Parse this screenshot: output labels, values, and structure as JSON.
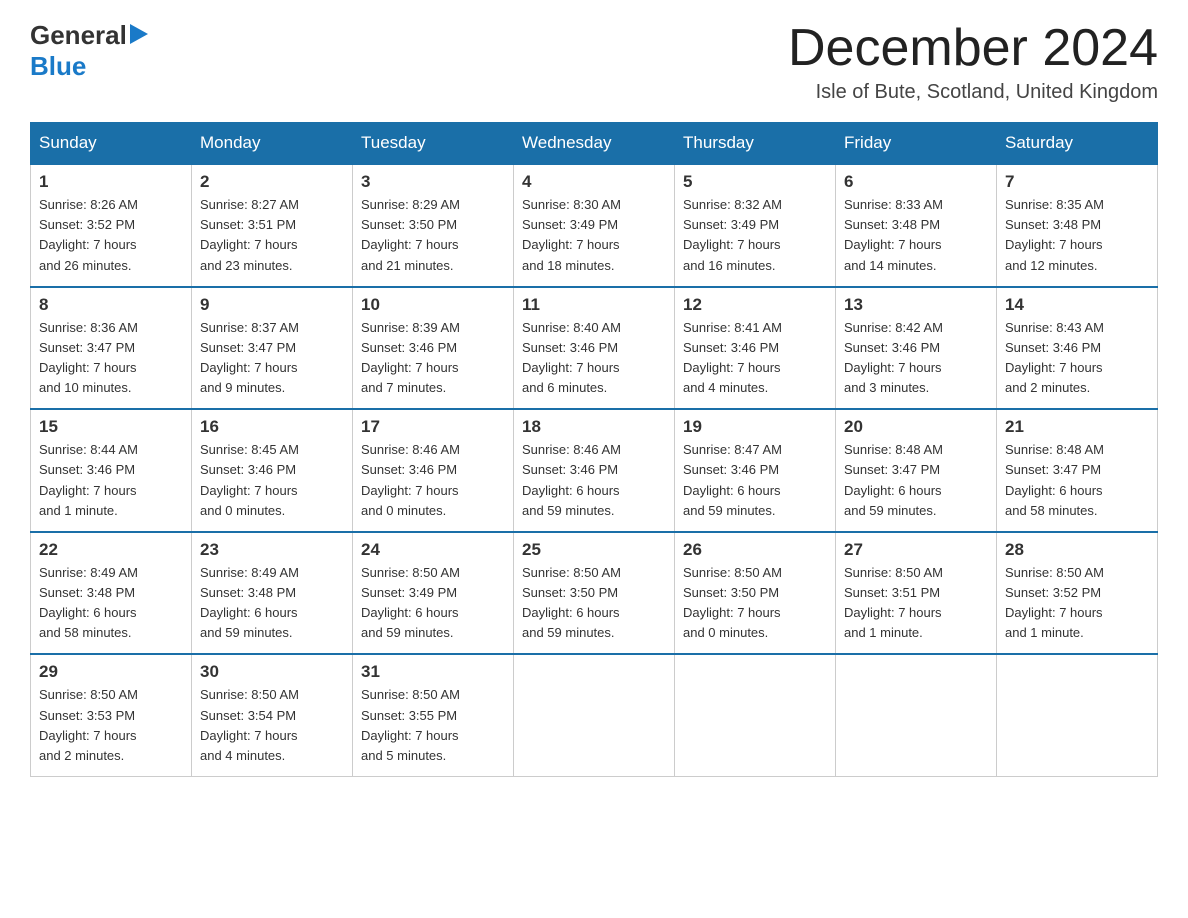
{
  "header": {
    "logo_line1": "General",
    "logo_arrow": "▶",
    "logo_line2": "Blue",
    "title": "December 2024",
    "location": "Isle of Bute, Scotland, United Kingdom"
  },
  "columns": [
    "Sunday",
    "Monday",
    "Tuesday",
    "Wednesday",
    "Thursday",
    "Friday",
    "Saturday"
  ],
  "weeks": [
    [
      {
        "day": "1",
        "info": "Sunrise: 8:26 AM\nSunset: 3:52 PM\nDaylight: 7 hours\nand 26 minutes."
      },
      {
        "day": "2",
        "info": "Sunrise: 8:27 AM\nSunset: 3:51 PM\nDaylight: 7 hours\nand 23 minutes."
      },
      {
        "day": "3",
        "info": "Sunrise: 8:29 AM\nSunset: 3:50 PM\nDaylight: 7 hours\nand 21 minutes."
      },
      {
        "day": "4",
        "info": "Sunrise: 8:30 AM\nSunset: 3:49 PM\nDaylight: 7 hours\nand 18 minutes."
      },
      {
        "day": "5",
        "info": "Sunrise: 8:32 AM\nSunset: 3:49 PM\nDaylight: 7 hours\nand 16 minutes."
      },
      {
        "day": "6",
        "info": "Sunrise: 8:33 AM\nSunset: 3:48 PM\nDaylight: 7 hours\nand 14 minutes."
      },
      {
        "day": "7",
        "info": "Sunrise: 8:35 AM\nSunset: 3:48 PM\nDaylight: 7 hours\nand 12 minutes."
      }
    ],
    [
      {
        "day": "8",
        "info": "Sunrise: 8:36 AM\nSunset: 3:47 PM\nDaylight: 7 hours\nand 10 minutes."
      },
      {
        "day": "9",
        "info": "Sunrise: 8:37 AM\nSunset: 3:47 PM\nDaylight: 7 hours\nand 9 minutes."
      },
      {
        "day": "10",
        "info": "Sunrise: 8:39 AM\nSunset: 3:46 PM\nDaylight: 7 hours\nand 7 minutes."
      },
      {
        "day": "11",
        "info": "Sunrise: 8:40 AM\nSunset: 3:46 PM\nDaylight: 7 hours\nand 6 minutes."
      },
      {
        "day": "12",
        "info": "Sunrise: 8:41 AM\nSunset: 3:46 PM\nDaylight: 7 hours\nand 4 minutes."
      },
      {
        "day": "13",
        "info": "Sunrise: 8:42 AM\nSunset: 3:46 PM\nDaylight: 7 hours\nand 3 minutes."
      },
      {
        "day": "14",
        "info": "Sunrise: 8:43 AM\nSunset: 3:46 PM\nDaylight: 7 hours\nand 2 minutes."
      }
    ],
    [
      {
        "day": "15",
        "info": "Sunrise: 8:44 AM\nSunset: 3:46 PM\nDaylight: 7 hours\nand 1 minute."
      },
      {
        "day": "16",
        "info": "Sunrise: 8:45 AM\nSunset: 3:46 PM\nDaylight: 7 hours\nand 0 minutes."
      },
      {
        "day": "17",
        "info": "Sunrise: 8:46 AM\nSunset: 3:46 PM\nDaylight: 7 hours\nand 0 minutes."
      },
      {
        "day": "18",
        "info": "Sunrise: 8:46 AM\nSunset: 3:46 PM\nDaylight: 6 hours\nand 59 minutes."
      },
      {
        "day": "19",
        "info": "Sunrise: 8:47 AM\nSunset: 3:46 PM\nDaylight: 6 hours\nand 59 minutes."
      },
      {
        "day": "20",
        "info": "Sunrise: 8:48 AM\nSunset: 3:47 PM\nDaylight: 6 hours\nand 59 minutes."
      },
      {
        "day": "21",
        "info": "Sunrise: 8:48 AM\nSunset: 3:47 PM\nDaylight: 6 hours\nand 58 minutes."
      }
    ],
    [
      {
        "day": "22",
        "info": "Sunrise: 8:49 AM\nSunset: 3:48 PM\nDaylight: 6 hours\nand 58 minutes."
      },
      {
        "day": "23",
        "info": "Sunrise: 8:49 AM\nSunset: 3:48 PM\nDaylight: 6 hours\nand 59 minutes."
      },
      {
        "day": "24",
        "info": "Sunrise: 8:50 AM\nSunset: 3:49 PM\nDaylight: 6 hours\nand 59 minutes."
      },
      {
        "day": "25",
        "info": "Sunrise: 8:50 AM\nSunset: 3:50 PM\nDaylight: 6 hours\nand 59 minutes."
      },
      {
        "day": "26",
        "info": "Sunrise: 8:50 AM\nSunset: 3:50 PM\nDaylight: 7 hours\nand 0 minutes."
      },
      {
        "day": "27",
        "info": "Sunrise: 8:50 AM\nSunset: 3:51 PM\nDaylight: 7 hours\nand 1 minute."
      },
      {
        "day": "28",
        "info": "Sunrise: 8:50 AM\nSunset: 3:52 PM\nDaylight: 7 hours\nand 1 minute."
      }
    ],
    [
      {
        "day": "29",
        "info": "Sunrise: 8:50 AM\nSunset: 3:53 PM\nDaylight: 7 hours\nand 2 minutes."
      },
      {
        "day": "30",
        "info": "Sunrise: 8:50 AM\nSunset: 3:54 PM\nDaylight: 7 hours\nand 4 minutes."
      },
      {
        "day": "31",
        "info": "Sunrise: 8:50 AM\nSunset: 3:55 PM\nDaylight: 7 hours\nand 5 minutes."
      },
      {
        "day": "",
        "info": ""
      },
      {
        "day": "",
        "info": ""
      },
      {
        "day": "",
        "info": ""
      },
      {
        "day": "",
        "info": ""
      }
    ]
  ]
}
